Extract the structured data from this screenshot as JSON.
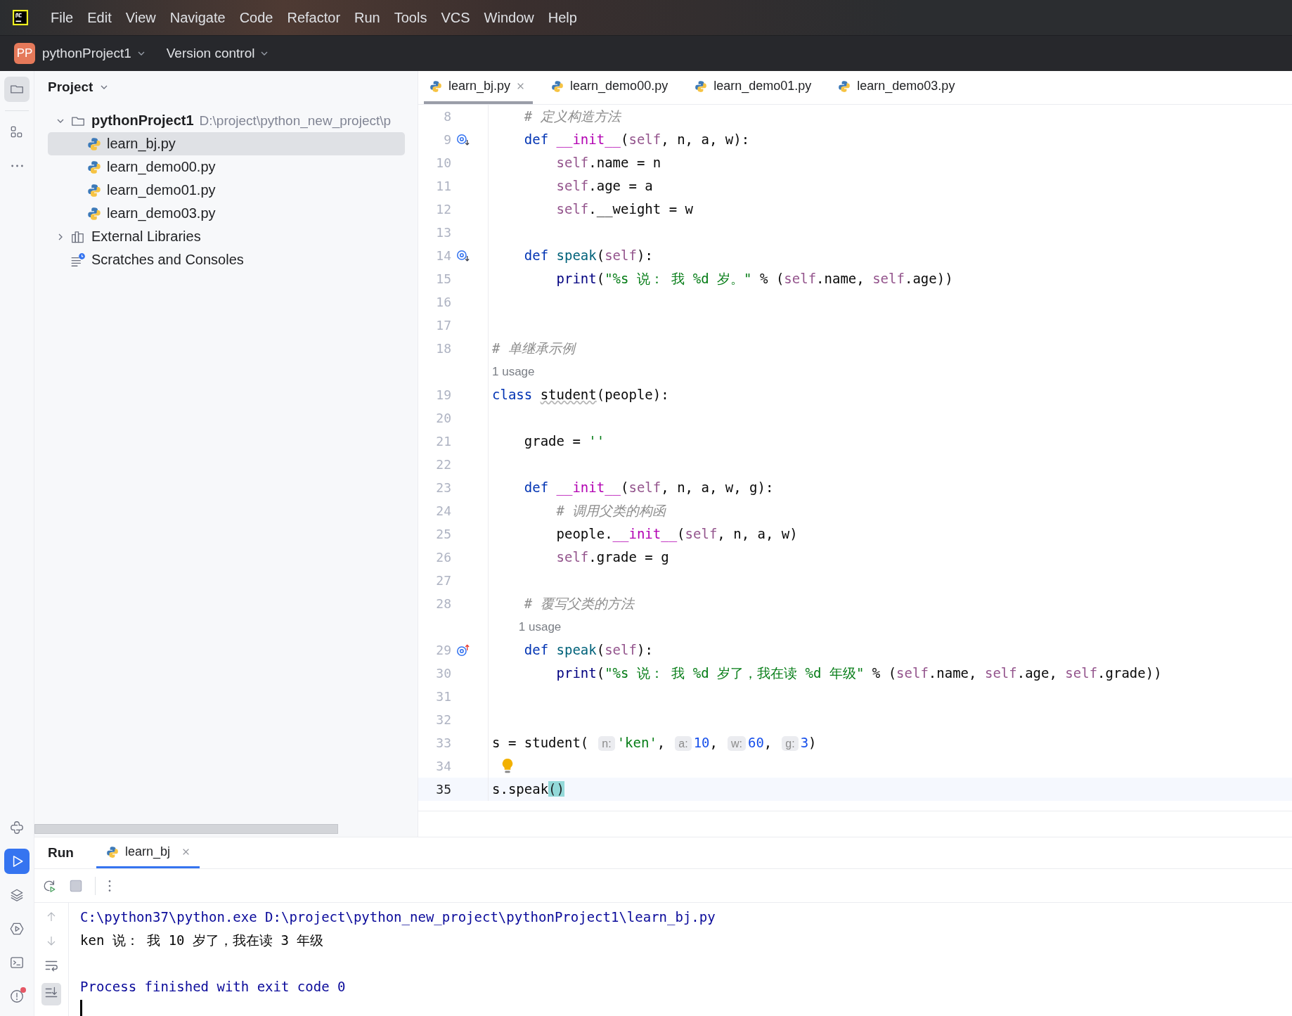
{
  "menu_bar": {
    "items": [
      "File",
      "Edit",
      "View",
      "Navigate",
      "Code",
      "Refactor",
      "Run",
      "Tools",
      "VCS",
      "Window",
      "Help"
    ]
  },
  "toolbar": {
    "project_badge": "PP",
    "project": "pythonProject1",
    "vcs": "Version control"
  },
  "tool_strip": {
    "top": [
      {
        "kind": "folder",
        "selected": true
      },
      {
        "kind": "structure",
        "selected": false
      },
      {
        "kind": "more",
        "selected": false
      }
    ],
    "bottom": [
      {
        "kind": "python",
        "selected": false
      },
      {
        "kind": "run",
        "selected": true
      },
      {
        "kind": "layers",
        "selected": false
      },
      {
        "kind": "services",
        "selected": false
      },
      {
        "kind": "terminal",
        "selected": false
      },
      {
        "kind": "problems",
        "selected": false,
        "alert": true
      }
    ]
  },
  "project_panel": {
    "title": "Project",
    "tree": [
      {
        "kind": "folder",
        "label": "pythonProject1",
        "path": "D:\\project\\python_new_project\\p",
        "expanded": true,
        "selected": false,
        "children": [
          {
            "kind": "python",
            "label": "learn_bj.py",
            "selected": true
          },
          {
            "kind": "python",
            "label": "learn_demo00.py",
            "selected": false
          },
          {
            "kind": "python",
            "label": "learn_demo01.py",
            "selected": false
          },
          {
            "kind": "python",
            "label": "learn_demo03.py",
            "selected": false
          }
        ]
      },
      {
        "kind": "libraries",
        "label": "External Libraries",
        "expanded": false,
        "selected": false
      },
      {
        "kind": "scratches",
        "label": "Scratches and Consoles",
        "selected": false
      }
    ]
  },
  "editor": {
    "tabs": [
      {
        "label": "learn_bj.py",
        "selected": true
      },
      {
        "label": "learn_demo00.py",
        "selected": false
      },
      {
        "label": "learn_demo01.py",
        "selected": false
      },
      {
        "label": "learn_demo03.py",
        "selected": false
      }
    ],
    "lines": [
      {
        "number": "8",
        "current": false,
        "tokens": [
          {
            "kind": "comment",
            "text": "    # 定义构造方法"
          }
        ]
      },
      {
        "number": "9",
        "current": false,
        "marker": {
          "kind": "override-down"
        },
        "tokens": [
          {
            "kind": "keyword",
            "text": "    def "
          },
          {
            "kind": "magic",
            "text": "__init__"
          },
          {
            "kind": "plain",
            "text": "("
          },
          {
            "kind": "self",
            "text": "self"
          },
          {
            "kind": "plain",
            "text": ", n, a, w):"
          }
        ]
      },
      {
        "number": "10",
        "current": false,
        "tokens": [
          {
            "kind": "self",
            "text": "        self"
          },
          {
            "kind": "plain",
            "text": ".name = n"
          }
        ]
      },
      {
        "number": "11",
        "current": false,
        "tokens": [
          {
            "kind": "self",
            "text": "        self"
          },
          {
            "kind": "plain",
            "text": ".age = a"
          }
        ]
      },
      {
        "number": "12",
        "current": false,
        "tokens": [
          {
            "kind": "self",
            "text": "        self"
          },
          {
            "kind": "plain",
            "text": ".__weight = w"
          }
        ]
      },
      {
        "number": "13",
        "current": false
      },
      {
        "number": "14",
        "current": false,
        "marker": {
          "kind": "override-down"
        },
        "tokens": [
          {
            "kind": "keyword",
            "text": "    def "
          },
          {
            "kind": "function",
            "text": "speak"
          },
          {
            "kind": "plain",
            "text": "("
          },
          {
            "kind": "self",
            "text": "self"
          },
          {
            "kind": "plain",
            "text": "):"
          }
        ]
      },
      {
        "number": "15",
        "current": false,
        "tokens": [
          {
            "kind": "builtin",
            "text": "        print"
          },
          {
            "kind": "plain",
            "text": "("
          },
          {
            "kind": "string",
            "text": "\"%s 说： 我 %d 岁。\""
          },
          {
            "kind": "plain",
            "text": " % ("
          },
          {
            "kind": "self",
            "text": "self"
          },
          {
            "kind": "plain",
            "text": ".name, "
          },
          {
            "kind": "self",
            "text": "self"
          },
          {
            "kind": "plain",
            "text": ".age))"
          }
        ]
      },
      {
        "number": "16",
        "current": false
      },
      {
        "number": "17",
        "current": false
      },
      {
        "number": "18",
        "current": false,
        "tokens": [
          {
            "kind": "comment",
            "text": "# 单继承示例"
          }
        ]
      },
      {
        "kind": "usage",
        "indented": false,
        "text": "1 usage"
      },
      {
        "number": "19",
        "current": false,
        "tokens": [
          {
            "kind": "keyword",
            "text": "class "
          },
          {
            "kind": "warning",
            "text": "student"
          },
          {
            "kind": "plain",
            "text": "(people):"
          }
        ]
      },
      {
        "number": "20",
        "current": false
      },
      {
        "number": "21",
        "current": false,
        "tokens": [
          {
            "kind": "plain",
            "text": "    grade = "
          },
          {
            "kind": "string",
            "text": "''"
          }
        ]
      },
      {
        "number": "22",
        "current": false
      },
      {
        "number": "23",
        "current": false,
        "tokens": [
          {
            "kind": "keyword",
            "text": "    def "
          },
          {
            "kind": "magic",
            "text": "__init__"
          },
          {
            "kind": "plain",
            "text": "("
          },
          {
            "kind": "self",
            "text": "self"
          },
          {
            "kind": "plain",
            "text": ", n, a, w, g):"
          }
        ]
      },
      {
        "number": "24",
        "current": false,
        "tokens": [
          {
            "kind": "comment",
            "text": "        # 调用父类的构函"
          }
        ]
      },
      {
        "number": "25",
        "current": false,
        "tokens": [
          {
            "kind": "plain",
            "text": "        people."
          },
          {
            "kind": "magic",
            "text": "__init__"
          },
          {
            "kind": "plain",
            "text": "("
          },
          {
            "kind": "self",
            "text": "self"
          },
          {
            "kind": "plain",
            "text": ", n, a, w)"
          }
        ]
      },
      {
        "number": "26",
        "current": false,
        "tokens": [
          {
            "kind": "self",
            "text": "        self"
          },
          {
            "kind": "plain",
            "text": ".grade = g"
          }
        ]
      },
      {
        "number": "27",
        "current": false
      },
      {
        "number": "28",
        "current": false,
        "tokens": [
          {
            "kind": "comment",
            "text": "    # 覆写父类的方法"
          }
        ]
      },
      {
        "kind": "usage",
        "indented": true,
        "text": "1 usage"
      },
      {
        "number": "29",
        "current": false,
        "marker": {
          "kind": "override-up"
        },
        "tokens": [
          {
            "kind": "keyword",
            "text": "    def "
          },
          {
            "kind": "function",
            "text": "speak"
          },
          {
            "kind": "plain",
            "text": "("
          },
          {
            "kind": "self",
            "text": "self"
          },
          {
            "kind": "plain",
            "text": "):"
          }
        ]
      },
      {
        "number": "30",
        "current": false,
        "tokens": [
          {
            "kind": "builtin",
            "text": "        print"
          },
          {
            "kind": "plain",
            "text": "("
          },
          {
            "kind": "string",
            "text": "\"%s 说： 我 %d 岁了，我在读 %d 年级\""
          },
          {
            "kind": "plain",
            "text": " % ("
          },
          {
            "kind": "self",
            "text": "self"
          },
          {
            "kind": "plain",
            "text": ".name, "
          },
          {
            "kind": "self",
            "text": "self"
          },
          {
            "kind": "plain",
            "text": ".age, "
          },
          {
            "kind": "self",
            "text": "self"
          },
          {
            "kind": "plain",
            "text": ".grade))"
          }
        ]
      },
      {
        "number": "31",
        "current": false
      },
      {
        "number": "32",
        "current": false
      },
      {
        "number": "33",
        "current": false,
        "tokens": [
          {
            "kind": "plain",
            "text": "s = student("
          },
          {
            "kind": "hint",
            "text": "n:"
          },
          {
            "kind": "string",
            "text": "'ken'"
          },
          {
            "kind": "plain",
            "text": ","
          },
          {
            "kind": "hint",
            "text": "a:"
          },
          {
            "kind": "number",
            "text": "10"
          },
          {
            "kind": "plain",
            "text": ","
          },
          {
            "kind": "hint",
            "text": "w:"
          },
          {
            "kind": "number",
            "text": "60"
          },
          {
            "kind": "plain",
            "text": ","
          },
          {
            "kind": "hint",
            "text": "g:"
          },
          {
            "kind": "number",
            "text": "3"
          },
          {
            "kind": "plain",
            "text": ")"
          }
        ]
      },
      {
        "number": "34",
        "current": false,
        "marker": {
          "kind": "bulb"
        }
      },
      {
        "number": "35",
        "current": true,
        "tokens": [
          {
            "kind": "plain",
            "text": "s.speak"
          },
          {
            "kind": "match",
            "text": "()"
          }
        ]
      }
    ]
  },
  "run_panel": {
    "title": "Run",
    "tabs": [
      {
        "label": "learn_bj",
        "selected": true
      }
    ],
    "console": [
      {
        "kind": "command",
        "text": "C:\\python37\\python.exe D:\\project\\python_new_project\\pythonProject1\\learn_bj.py"
      },
      {
        "kind": "output",
        "text": "ken 说： 我 10 岁了，我在读 3 年级"
      },
      {
        "kind": "info",
        "text": "Process finished with exit code 0"
      }
    ]
  }
}
